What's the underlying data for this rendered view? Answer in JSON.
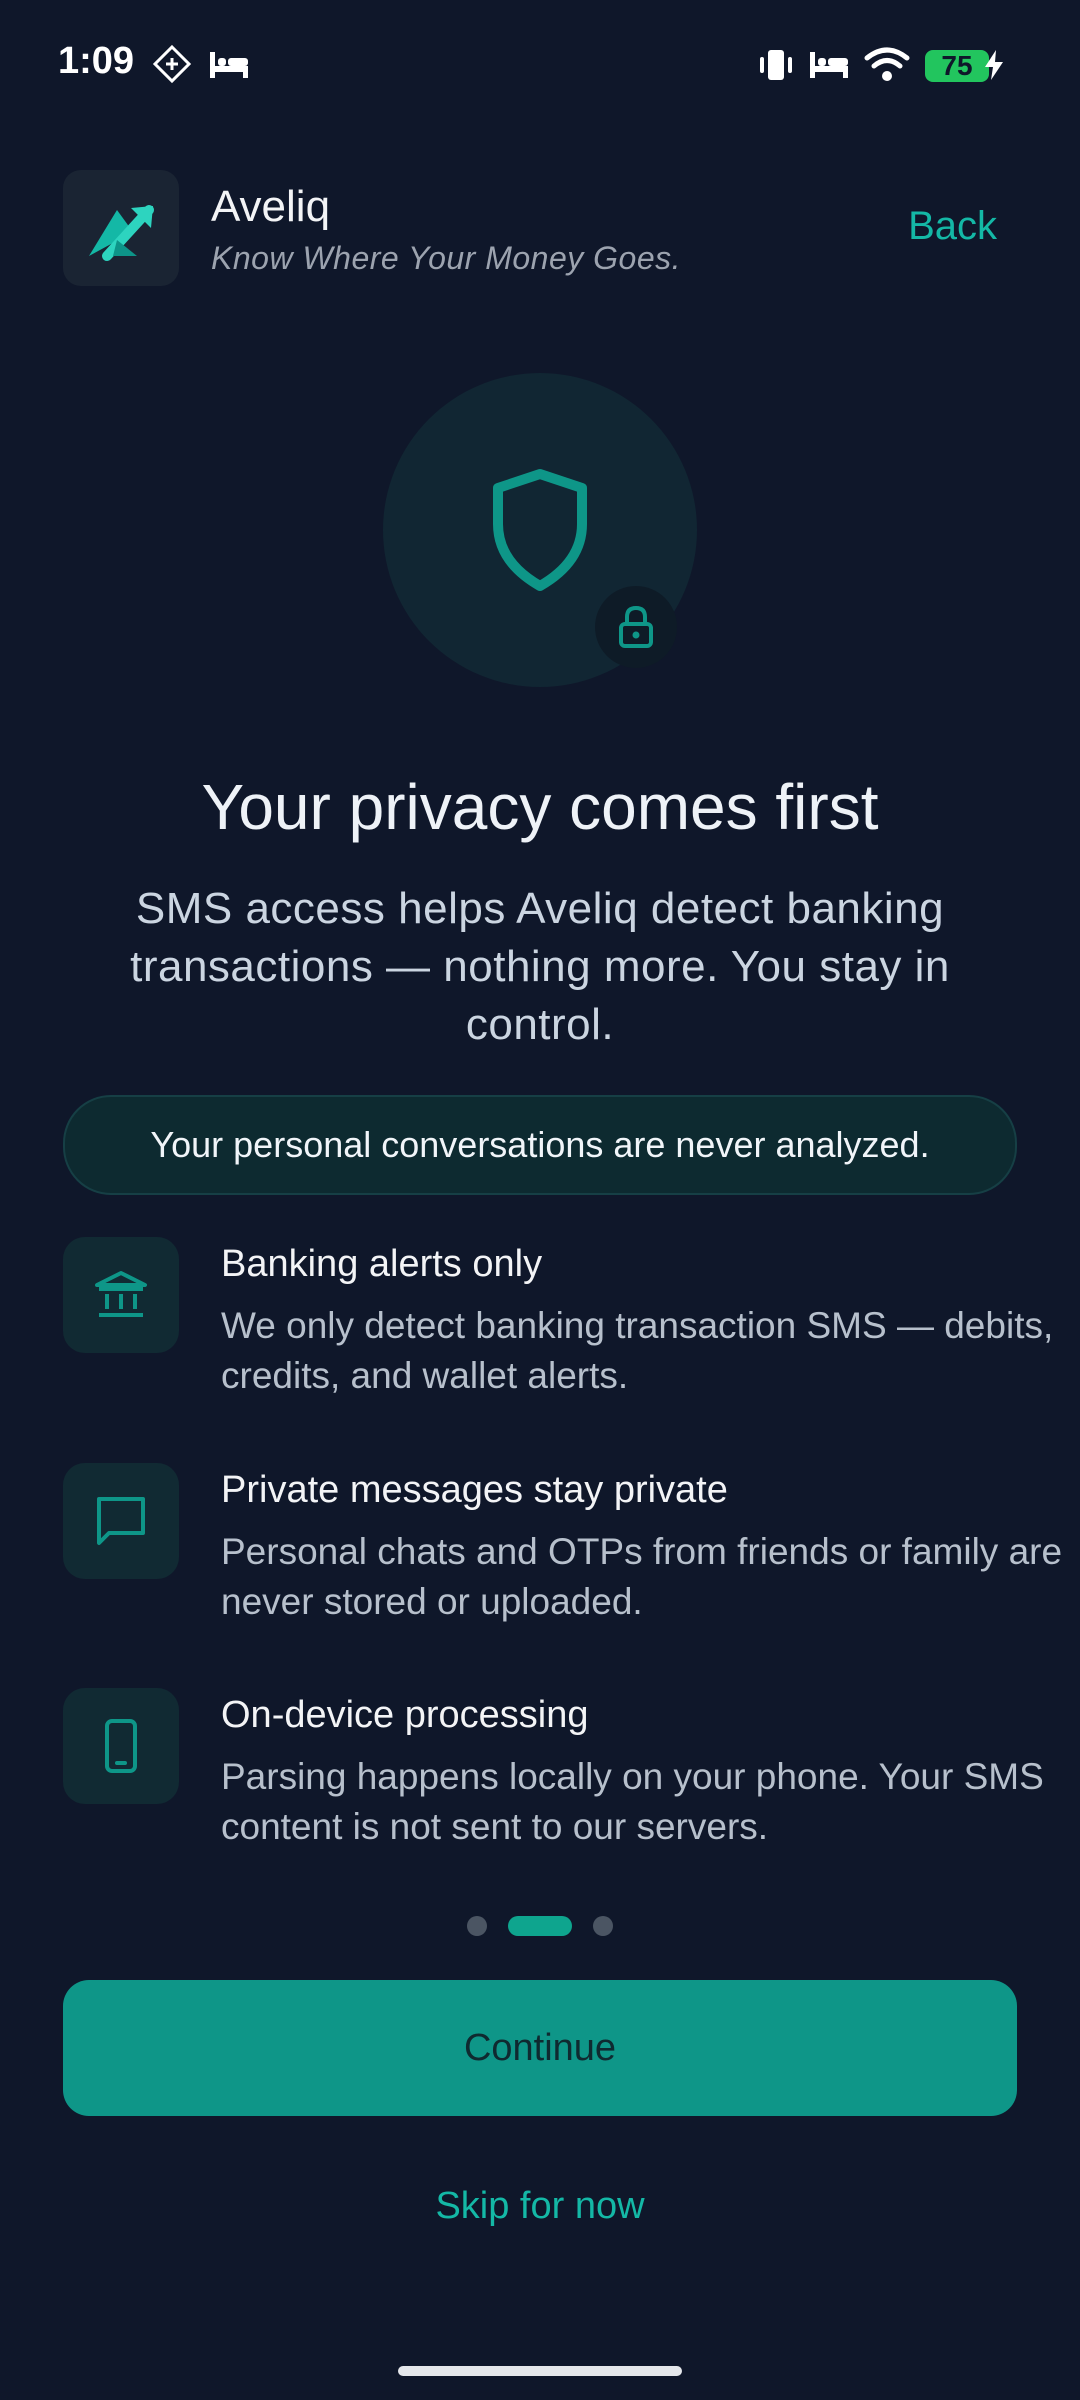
{
  "status_bar": {
    "time": "1:09",
    "battery": "75"
  },
  "header": {
    "app_name": "Aveliq",
    "tagline": "Know Where Your Money Goes.",
    "back_label": "Back"
  },
  "hero": {
    "icon": "shield-icon",
    "badge_icon": "lock-icon"
  },
  "content": {
    "title": "Your privacy comes first",
    "subtitle": "SMS access helps Aveliq detect banking transactions — nothing more. You stay in control.",
    "highlight": "Your personal conversations are never analyzed."
  },
  "features": [
    {
      "icon": "bank-icon",
      "title": "Banking alerts only",
      "description": "We only detect banking transaction SMS — debits, credits, and wallet alerts."
    },
    {
      "icon": "message-icon",
      "title": "Private messages stay private",
      "description": "Personal chats and OTPs from friends or family are never stored or uploaded."
    },
    {
      "icon": "phone-icon",
      "title": "On-device processing",
      "description": "Parsing happens locally on your phone. Your SMS content is not sent to our servers."
    }
  ],
  "pagination": {
    "current": 2,
    "total": 3
  },
  "actions": {
    "continue_label": "Continue",
    "skip_label": "Skip for now"
  },
  "colors": {
    "background": "#0f172a",
    "accent": "#14b8a6",
    "button": "#0e9688"
  }
}
